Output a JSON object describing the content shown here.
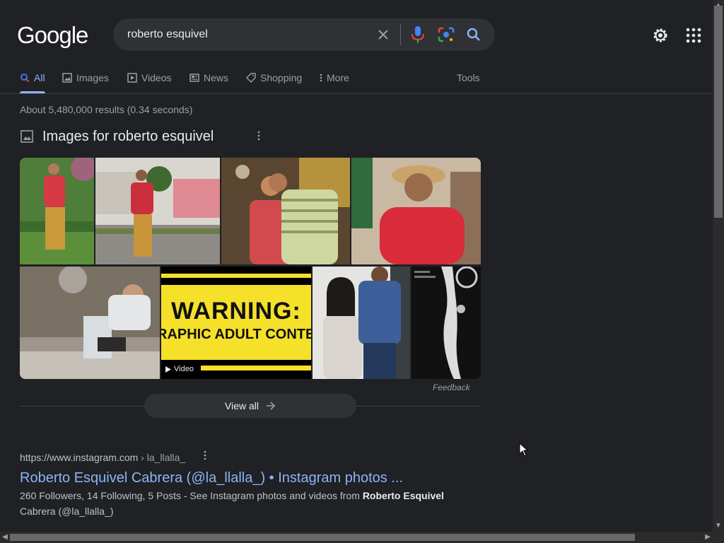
{
  "logo": "Google",
  "search": {
    "query": "roberto esquivel"
  },
  "tabs": [
    {
      "label": "All",
      "icon": "search-icon"
    },
    {
      "label": "Images",
      "icon": "image-icon"
    },
    {
      "label": "Videos",
      "icon": "video-icon"
    },
    {
      "label": "News",
      "icon": "news-icon"
    },
    {
      "label": "Shopping",
      "icon": "tag-icon"
    },
    {
      "label": "More",
      "icon": "more-vert-icon"
    }
  ],
  "tools_label": "Tools",
  "result_stats": "About 5,480,000 results (0.34 seconds)",
  "images_section": {
    "title": "Images for roberto esquivel",
    "warning_line1": "WARNING:",
    "warning_line2": "RAPHIC ADULT CONTEN",
    "video_label": "Video",
    "feedback_label": "Feedback",
    "view_all_label": "View all"
  },
  "result": {
    "url_base": "https://www.instagram.com",
    "url_crumb": " › la_llalla_",
    "title": "Roberto Esquivel Cabrera (@la_llalla_) • Instagram photos ...",
    "snippet_before": "260 Followers, 14 Following, 5 Posts - See Instagram photos and videos from ",
    "snippet_bold": "Roberto Esquivel",
    "snippet_line2": "Cabrera (@la_llalla_)"
  },
  "colors": {
    "background": "#202124",
    "link": "#8ab4f8",
    "searchbox": "#303134",
    "text_secondary": "#9aa0a6"
  }
}
